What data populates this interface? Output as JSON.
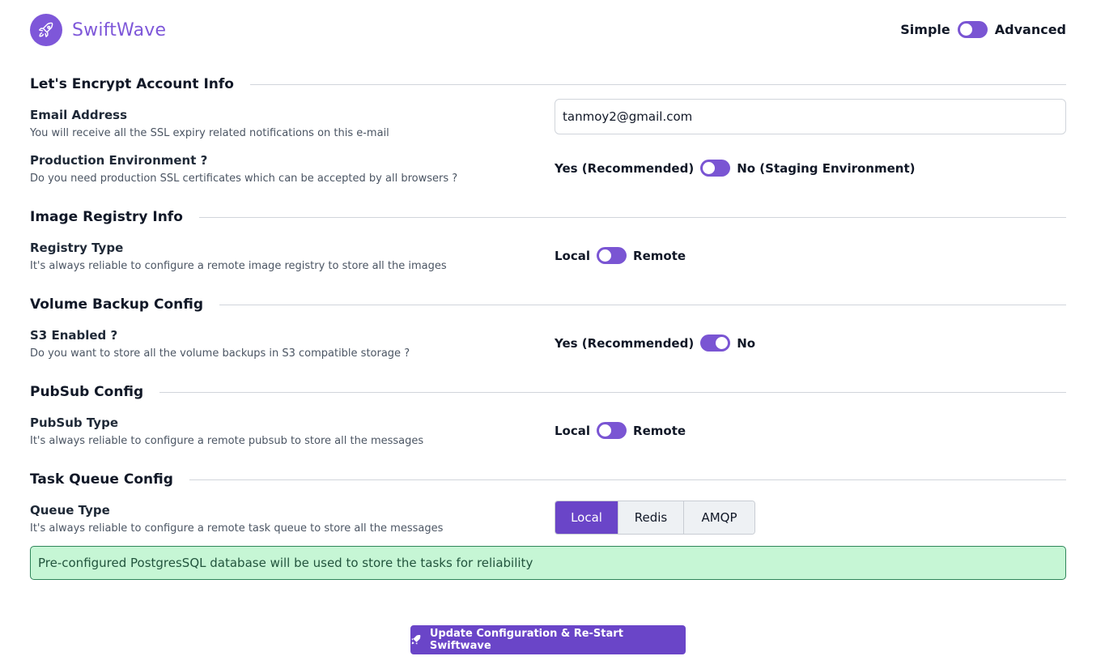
{
  "header": {
    "brand": "SwiftWave",
    "logo_icon": "rocket-icon",
    "mode_left_label": "Simple",
    "mode_right_label": "Advanced",
    "mode_toggle_state": "advanced"
  },
  "sections": {
    "letsencrypt": {
      "title": "Let's Encrypt Account Info",
      "email_label": "Email Address",
      "email_desc": "You will receive all the SSL expiry related notifications on this e-mail",
      "email_value": "tanmoy2@gmail.com",
      "prod_label": "Production Environment ?",
      "prod_desc": "Do you need production SSL certificates which can be accepted by all browsers ?",
      "prod_left": "Yes (Recommended)",
      "prod_right": "No (Staging Environment)",
      "prod_state": "yes"
    },
    "registry": {
      "title": "Image Registry Info",
      "type_label": "Registry Type",
      "type_desc": "It's always reliable to configure a remote image registry to store all the images",
      "left": "Local",
      "right": "Remote",
      "state": "local"
    },
    "volume": {
      "title": "Volume Backup Config",
      "s3_label": "S3 Enabled ?",
      "s3_desc": "Do you want to store all the volume backups in S3 compatible storage ?",
      "left": "Yes (Recommended)",
      "right": "No",
      "state": "no"
    },
    "pubsub": {
      "title": "PubSub Config",
      "type_label": "PubSub Type",
      "type_desc": "It's always reliable to configure a remote pubsub to store all the messages",
      "left": "Local",
      "right": "Remote",
      "state": "local"
    },
    "taskqueue": {
      "title": "Task Queue Config",
      "type_label": "Queue Type",
      "type_desc": "It's always reliable to configure a remote task queue to store all the messages",
      "options": [
        "Local",
        "Redis",
        "AMQP"
      ],
      "selected": "Local",
      "notice": "Pre-configured PostgresSQL database will be used to store the tasks for reliability"
    }
  },
  "submit": {
    "label": "Update Configuration & Re-Start Swiftwave",
    "icon": "rocket-icon"
  },
  "colors": {
    "accent": "#6a45c8",
    "brand": "#7e57d9",
    "notice_bg": "#c6f6d5",
    "notice_border": "#2f855a"
  }
}
